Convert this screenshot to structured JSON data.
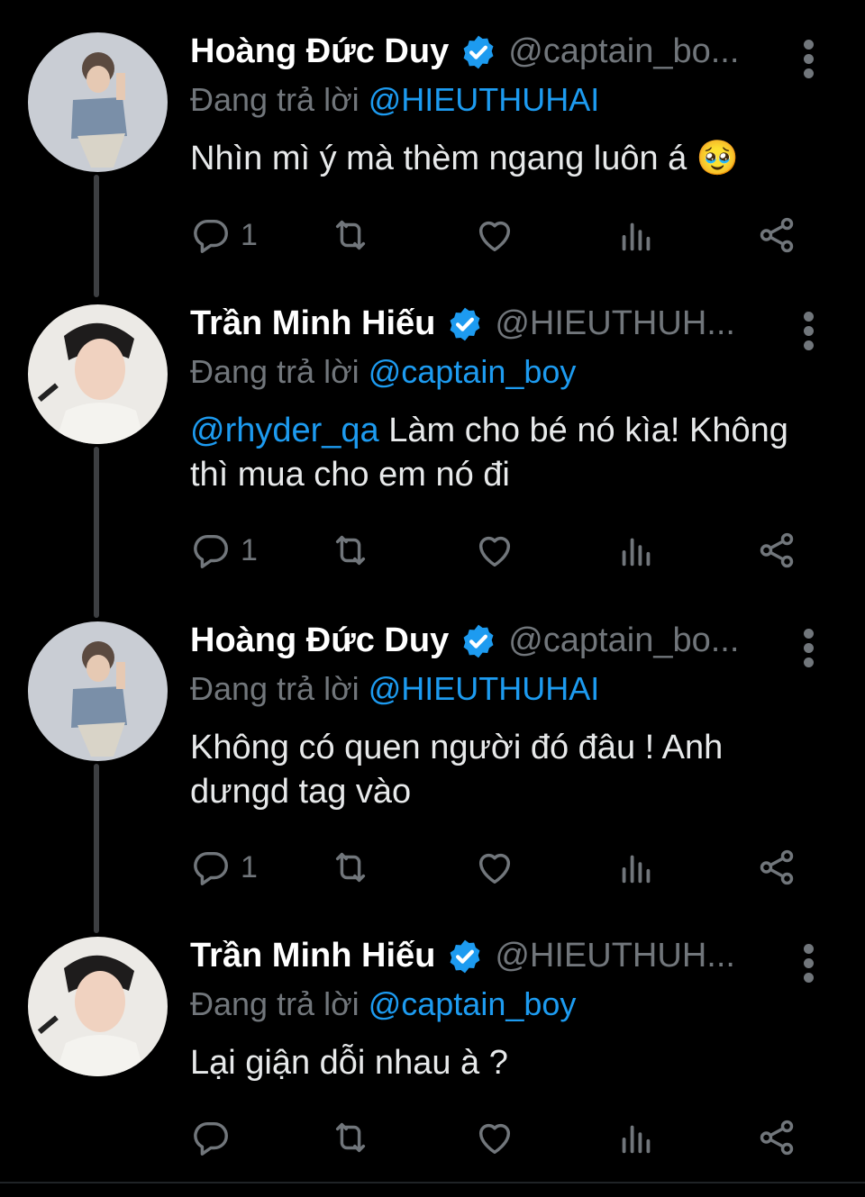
{
  "tweets": [
    {
      "name": "Hoàng Đức Duy",
      "handle": "@captain_bo...",
      "reply_prefix": "Đang trả lời",
      "reply_to": "@HIEUTHUHAI",
      "text": "Nhìn mì ý mà thèm ngang luôn á 🥹",
      "text_mention": "",
      "reply_count": "1",
      "avatar": "avatar-duy"
    },
    {
      "name": "Trần Minh Hiếu",
      "handle": "@HIEUTHUH...",
      "reply_prefix": "Đang trả lời",
      "reply_to": "@captain_boy",
      "text_mention": "@rhyder_qa",
      "text": " Làm cho bé nó kìa! Không thì mua cho em nó đi",
      "reply_count": "1",
      "avatar": "avatar-hieu"
    },
    {
      "name": "Hoàng Đức Duy",
      "handle": "@captain_bo...",
      "reply_prefix": "Đang trả lời",
      "reply_to": "@HIEUTHUHAI",
      "text": "Không có quen người đó đâu ! Anh dưngd tag vào",
      "text_mention": "",
      "reply_count": "1",
      "avatar": "avatar-duy"
    },
    {
      "name": "Trần Minh Hiếu",
      "handle": "@HIEUTHUH...",
      "reply_prefix": "Đang trả lời",
      "reply_to": "@captain_boy",
      "text": "Lại giận dỗi nhau à ?",
      "text_mention": "",
      "reply_count": "",
      "avatar": "avatar-hieu"
    }
  ],
  "colors": {
    "background": "#000000",
    "accent": "#1d9bf0",
    "muted": "#71767b",
    "text": "#e7e9ea"
  },
  "icons": [
    "verified-badge-icon",
    "more-vertical-icon",
    "reply-icon",
    "retweet-icon",
    "like-icon",
    "views-icon",
    "share-icon"
  ]
}
